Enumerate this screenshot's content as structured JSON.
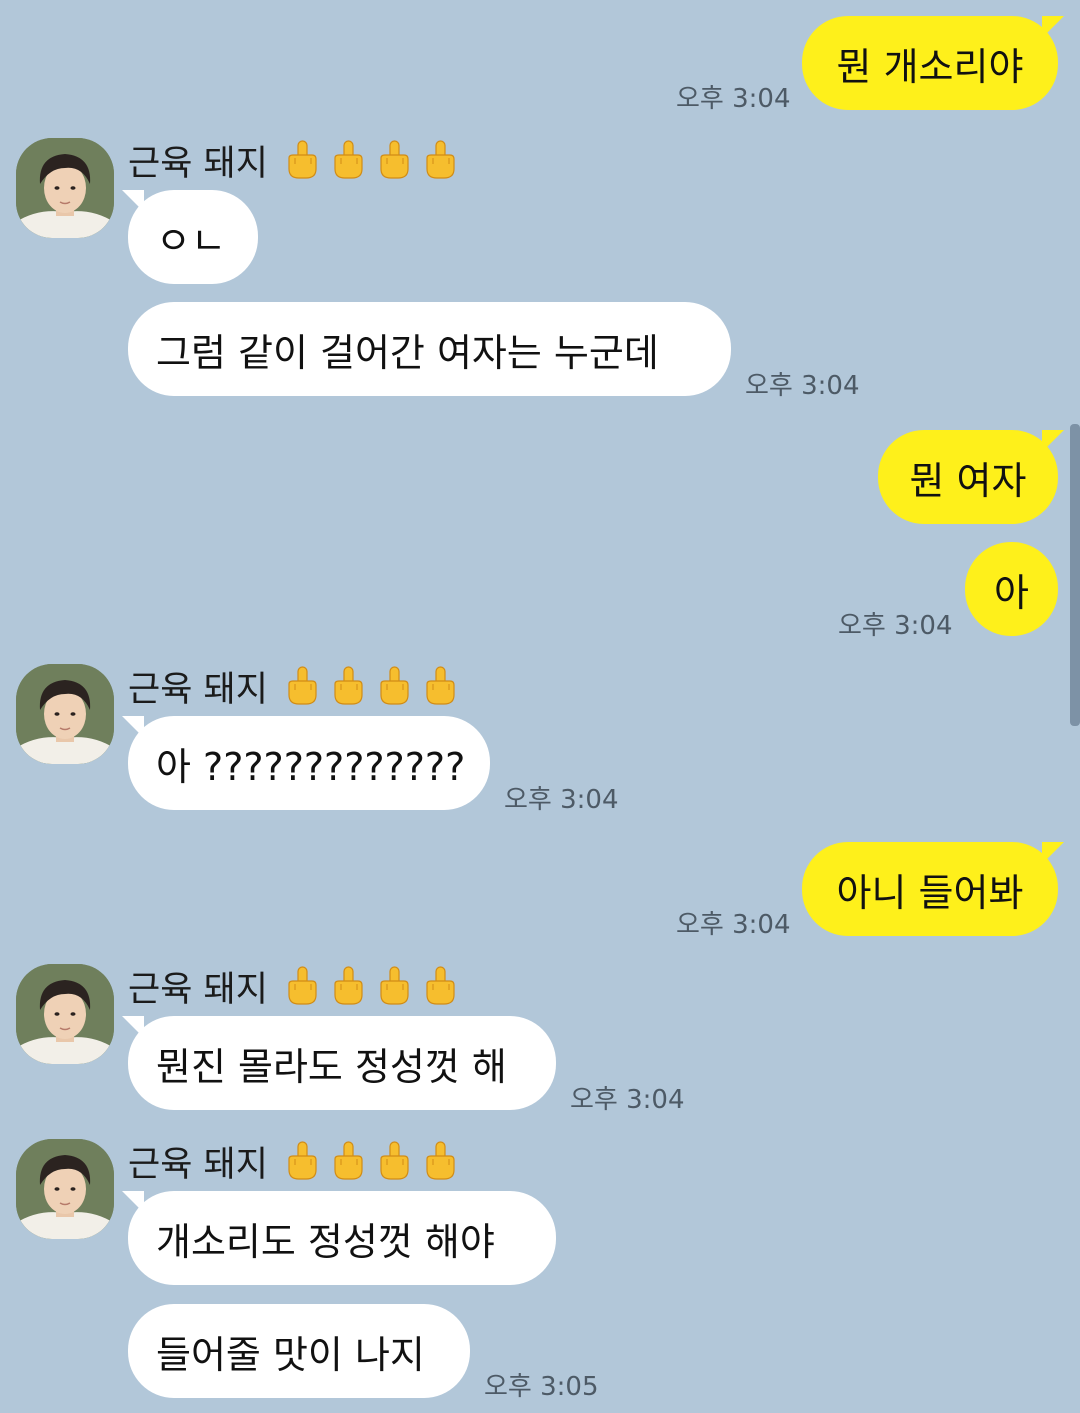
{
  "chat": {
    "sender": {
      "name": "근육 돼지",
      "icons": [
        "middle-finger-icon",
        "middle-finger-icon",
        "middle-finger-icon",
        "middle-finger-icon"
      ]
    },
    "messages": [
      {
        "from": "me",
        "text": "뭔 개소리야",
        "time": "오후 3:04"
      },
      {
        "from": "them",
        "text": "ㅇㄴ"
      },
      {
        "from": "them",
        "text": "그럼 같이 걸어간 여자는 누군데",
        "time": "오후 3:04"
      },
      {
        "from": "me",
        "text": "뭔 여자"
      },
      {
        "from": "me",
        "text": "아",
        "time": "오후 3:04"
      },
      {
        "from": "them",
        "text": "아 ?????????????",
        "time": "오후 3:04"
      },
      {
        "from": "me",
        "text": "아니 들어봐",
        "time": "오후 3:04"
      },
      {
        "from": "them",
        "text": "뭔진 몰라도 정성껏 해",
        "time": "오후 3:04"
      },
      {
        "from": "them",
        "text": "개소리도 정성껏 해야"
      },
      {
        "from": "them",
        "text": "들어줄 맛이 나지",
        "time": "오후 3:05"
      }
    ]
  },
  "colors": {
    "background": "#b2c7d9",
    "my_bubble": "#fef01b",
    "their_bubble": "#ffffff",
    "time_text": "#4d5a66"
  }
}
